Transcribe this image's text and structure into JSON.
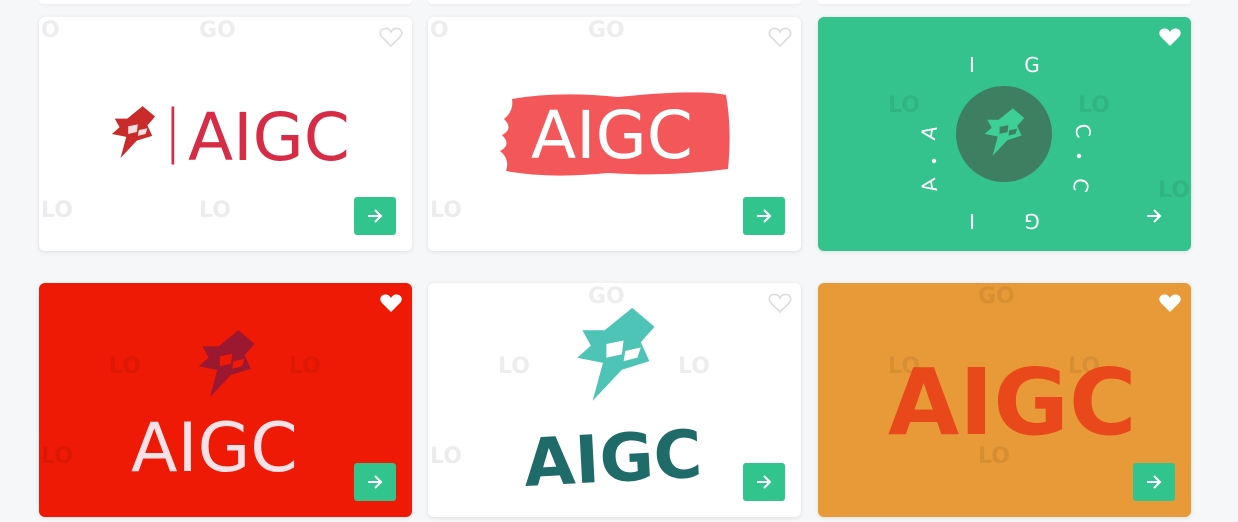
{
  "colors": {
    "accent": "#31c48d",
    "card1_bg": "#ffffff",
    "card2_bg": "#ffffff",
    "card3_bg": "#34c38c",
    "card4_bg": "#ee1a06",
    "card5_bg": "#ffffff",
    "card6_bg": "#e89a38"
  },
  "icons": {
    "favorite": "heart-icon",
    "open": "arrow-right-icon"
  },
  "cards": [
    {
      "logo_text": "AIGC",
      "separator": "|",
      "favorited": false
    },
    {
      "logo_text": "AIGC",
      "favorited": false
    },
    {
      "ring_letters": [
        "A",
        "I",
        "G",
        "C",
        "A",
        "I",
        "G",
        "C"
      ],
      "favorited": true
    },
    {
      "logo_text": "AIGC",
      "favorited": true
    },
    {
      "logo_text": "AIGC",
      "favorited": false
    },
    {
      "logo_text": "AIGC",
      "favorited": true
    }
  ],
  "watermark_text": "LOGO"
}
